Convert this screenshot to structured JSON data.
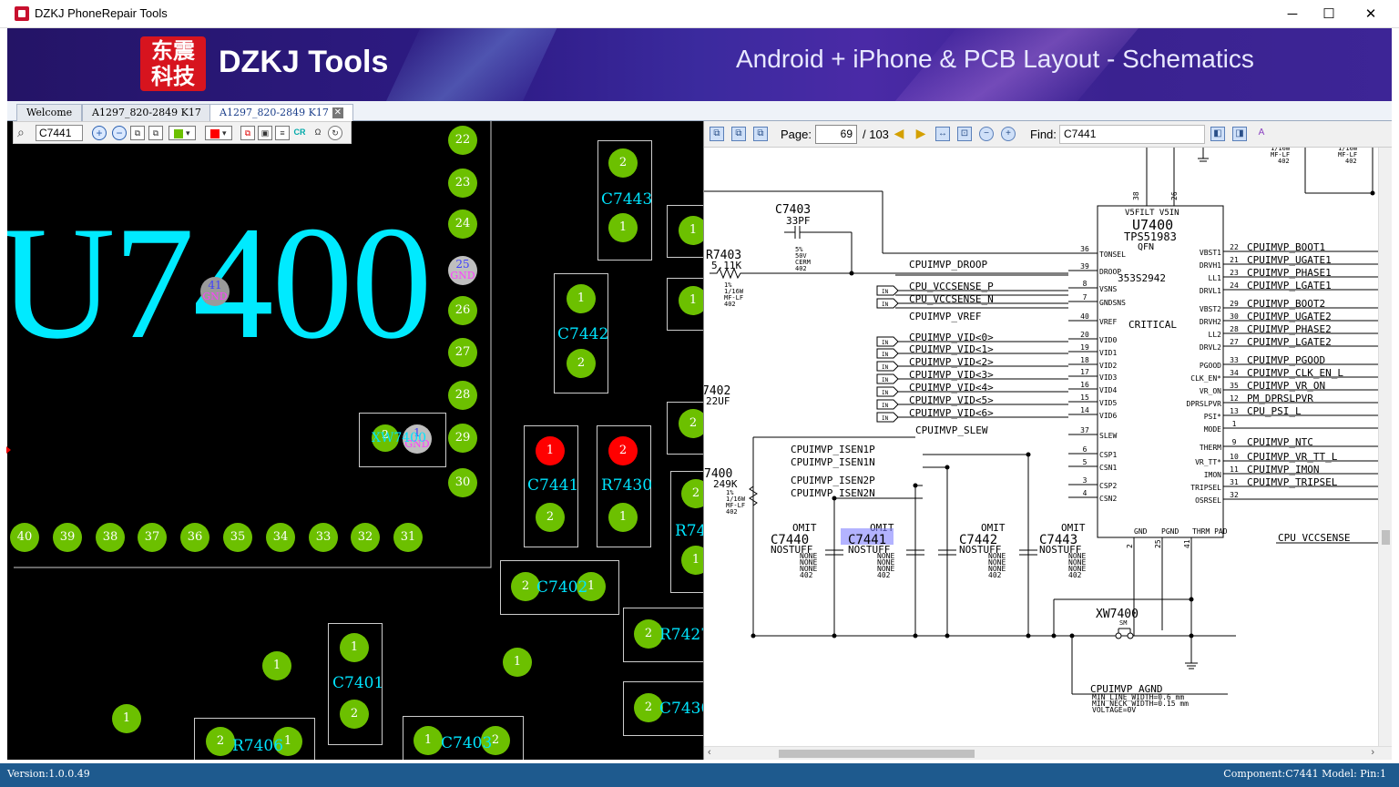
{
  "app": {
    "title": "DZKJ PhoneRepair Tools",
    "version": "Version:1.0.0.49"
  },
  "window_controls": {
    "minimize": "─",
    "maximize": "☐",
    "close": "✕"
  },
  "banner": {
    "logo": "东震\n科技",
    "brand": "DZKJ Tools",
    "slogan": "Android + iPhone & PCB Layout - Schematics"
  },
  "tabs": [
    {
      "label": "Welcome",
      "active": false
    },
    {
      "label": "A1297_820-2849 K17",
      "active": false
    },
    {
      "label": "A1297_820-2849 K17",
      "active": true
    }
  ],
  "pcb": {
    "search_value": "C7441",
    "big_label": "U7400",
    "colors": {
      "pad": "#6cc000",
      "pad_selected": "#ff0000",
      "label": "#00eaff"
    },
    "pad_numbers_right_col": [
      "22",
      "23",
      "24",
      "25",
      "26",
      "27",
      "28",
      "29",
      "30"
    ],
    "pad_numbers_bottom_row": [
      "40",
      "39",
      "38",
      "37",
      "36",
      "35",
      "34",
      "33",
      "32",
      "31"
    ],
    "gnd_label": "GND",
    "pad41": "41",
    "components": [
      "C7443",
      "C7442",
      "C7441",
      "R7430",
      "C7402",
      "R7427",
      "C7401",
      "C7430",
      "R7406",
      "C7403",
      "R74",
      "XW7400"
    ]
  },
  "schematic": {
    "page_label": "Page:",
    "page_current": "69",
    "page_total": "/ 103",
    "find_label": "Find:",
    "find_value": "C7441",
    "chip": {
      "v5": "V5FILT V5IN",
      "ref": "U7400",
      "part": "TPS51983",
      "pkg": "QFN",
      "pn": "353S2942",
      "critical": "CRITICAL"
    },
    "left_pins": [
      {
        "num": "36",
        "name": "TONSEL"
      },
      {
        "num": "39",
        "name": "DROOP"
      },
      {
        "num": "8",
        "name": "VSNS"
      },
      {
        "num": "7",
        "name": "GNDSNS"
      },
      {
        "num": "40",
        "name": "VREF"
      },
      {
        "num": "20",
        "name": "VID0"
      },
      {
        "num": "19",
        "name": "VID1"
      },
      {
        "num": "18",
        "name": "VID2"
      },
      {
        "num": "17",
        "name": "VID3"
      },
      {
        "num": "16",
        "name": "VID4"
      },
      {
        "num": "15",
        "name": "VID5"
      },
      {
        "num": "14",
        "name": "VID6"
      },
      {
        "num": "37",
        "name": "SLEW"
      },
      {
        "num": "6",
        "name": "CSP1"
      },
      {
        "num": "5",
        "name": "CSN1"
      },
      {
        "num": "3",
        "name": "CSP2"
      },
      {
        "num": "4",
        "name": "CSN2"
      }
    ],
    "left_nets": [
      "CPUIMVP_DROOP",
      "CPU_VCCSENSE_P",
      "CPU_VCCSENSE_N",
      "CPUIMVP_VREF",
      "CPUIMVP_VID<0>",
      "CPUIMVP_VID<1>",
      "CPUIMVP_VID<2>",
      "CPUIMVP_VID<3>",
      "CPUIMVP_VID<4>",
      "CPUIMVP_VID<5>",
      "CPUIMVP_VID<6>",
      "CPUIMVP_SLEW",
      "CPUIMVP_ISEN1P",
      "CPUIMVP_ISEN1N",
      "CPUIMVP_ISEN2P",
      "CPUIMVP_ISEN2N"
    ],
    "right_pins": [
      {
        "num": "22",
        "name": "VBST1",
        "net": "CPUIMVP_BOOT1"
      },
      {
        "num": "21",
        "name": "DRVH1",
        "net": "CPUIMVP_UGATE1"
      },
      {
        "num": "23",
        "name": "LL1",
        "net": "CPUIMVP_PHASE1"
      },
      {
        "num": "24",
        "name": "DRVL1",
        "net": "CPUIMVP_LGATE1"
      },
      {
        "num": "29",
        "name": "VBST2",
        "net": "CPUIMVP_BOOT2"
      },
      {
        "num": "30",
        "name": "DRVH2",
        "net": "CPUIMVP_UGATE2"
      },
      {
        "num": "28",
        "name": "LL2",
        "net": "CPUIMVP_PHASE2"
      },
      {
        "num": "27",
        "name": "DRVL2",
        "net": "CPUIMVP_LGATE2"
      },
      {
        "num": "33",
        "name": "PGOOD",
        "net": "CPUIMVP_PGOOD"
      },
      {
        "num": "34",
        "name": "CLK_EN*",
        "net": "CPUIMVP_CLK_EN_L"
      },
      {
        "num": "35",
        "name": "VR_ON",
        "net": "CPUIMVP_VR_ON"
      },
      {
        "num": "12",
        "name": "DPRSLPVR",
        "net": "PM_DPRSLPVR"
      },
      {
        "num": "13",
        "name": "PSI*",
        "net": "CPU_PSI_L"
      },
      {
        "num": "1",
        "name": "MODE",
        "net": ""
      },
      {
        "num": "9",
        "name": "THERM",
        "net": "CPUIMVP_NTC"
      },
      {
        "num": "10",
        "name": "VR_TT*",
        "net": "CPUIMVP_VR_TT_L"
      },
      {
        "num": "11",
        "name": "IMON",
        "net": "CPUIMVP_IMON"
      },
      {
        "num": "31",
        "name": "TRIPSEL",
        "net": "CPUIMVP_TRIPSEL"
      },
      {
        "num": "32",
        "name": "OSRSEL",
        "net": ""
      }
    ],
    "bottom_pins": [
      {
        "num": "2",
        "name": "GND"
      },
      {
        "num": "25",
        "name": "PGND"
      },
      {
        "num": "41",
        "name": "THRM PAD"
      }
    ],
    "c7403": {
      "ref": "C7403",
      "val": "33PF",
      "specs": [
        "5%",
        "50V",
        "CERM",
        "402"
      ]
    },
    "r7403": {
      "ref": "R7403",
      "val": "5.11K",
      "specs": [
        "1%",
        "1/16W",
        "MF-LF",
        "402"
      ]
    },
    "c7402": {
      "ref": "7402",
      "val": "22UF"
    },
    "r7400": {
      "ref": "7400",
      "val": "249K",
      "specs": [
        "1%",
        "1/16W",
        "MF-LF",
        "402"
      ]
    },
    "caps": [
      {
        "ref": "C7440",
        "omit": "OMIT",
        "val": "NOSTUFF",
        "specs": [
          "NONE",
          "NONE",
          "NONE",
          "402"
        ]
      },
      {
        "ref": "C7441",
        "omit": "OMIT",
        "val": "NOSTUFF",
        "specs": [
          "NONE",
          "NONE",
          "NONE",
          "402"
        ],
        "highlighted": true
      },
      {
        "ref": "C7442",
        "omit": "OMIT",
        "val": "NOSTUFF",
        "specs": [
          "NONE",
          "NONE",
          "NONE",
          "402"
        ]
      },
      {
        "ref": "C7443",
        "omit": "OMIT",
        "val": "NOSTUFF",
        "specs": [
          "NONE",
          "NONE",
          "NONE",
          "402"
        ]
      }
    ],
    "xw": {
      "ref": "XW7400",
      "type": "SM"
    },
    "agnd": {
      "net": "CPUIMVP_AGND",
      "notes": [
        "MIN_LINE_WIDTH=0.6 mm",
        "MIN_NECK_WIDTH=0.15 mm",
        "VOLTAGE=0V"
      ]
    },
    "vccsense": "CPU_VCCSENSE",
    "top_right_specs": [
      "1/16W",
      "MF-LF",
      "402"
    ],
    "in_tag": "IN",
    "highlight_color": "#8080ff"
  },
  "status": {
    "component_info": "Component:C7441 Model: Pin:1"
  }
}
